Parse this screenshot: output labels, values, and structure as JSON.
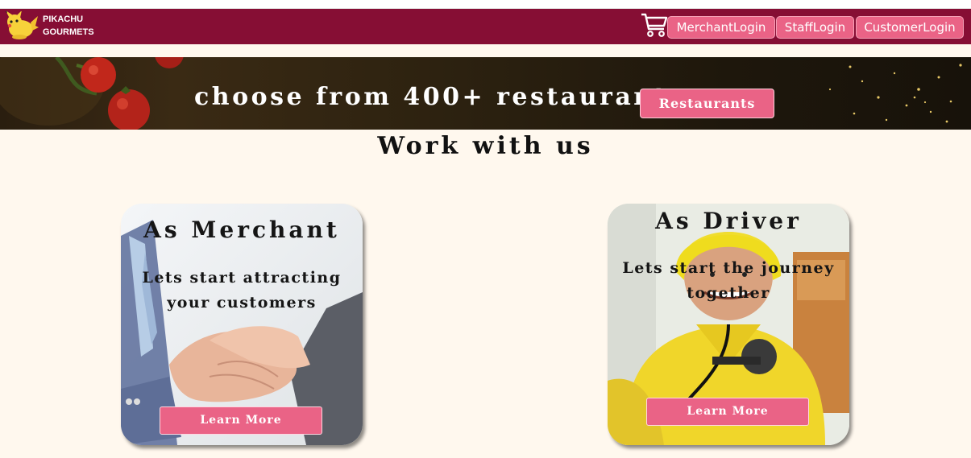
{
  "header": {
    "brand_line1": "PIKACHU",
    "brand_line2": "GOURMETS",
    "logo_icon": "pikachu-icon",
    "cart_icon": "cart-icon",
    "nav": [
      {
        "label": "MerchantLogin"
      },
      {
        "label": "StaffLogin"
      },
      {
        "label": "CustomerLogin"
      }
    ]
  },
  "banner": {
    "title": "choose from 400+ restaurant",
    "button_label": "Restaurants"
  },
  "work": {
    "title": "Work with us",
    "cards": [
      {
        "title": "As Merchant",
        "line1": "Lets start attracting",
        "line2": "your customers",
        "button_label": "Learn More"
      },
      {
        "title": "As Driver",
        "line1": "Lets start the journey",
        "line2": "together",
        "button_label": "Learn More"
      }
    ]
  },
  "colors": {
    "navbar": "#860e34",
    "accent_pink": "#ea6386",
    "page_bg": "#fff8ee"
  }
}
